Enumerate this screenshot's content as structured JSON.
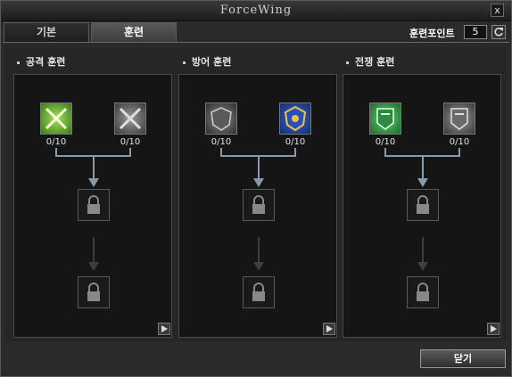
{
  "window": {
    "title": "ForceWing",
    "close_glyph": "x"
  },
  "tabs": [
    {
      "label": "기본",
      "active": false
    },
    {
      "label": "훈련",
      "active": true
    }
  ],
  "points": {
    "label": "훈련포인트",
    "value": "5"
  },
  "sections": [
    {
      "title": "공격 훈련",
      "left_count": "0/10",
      "right_count": "0/10",
      "left_icon": "green-crossed-swords-icon",
      "right_icon": "gray-crossed-swords-icon"
    },
    {
      "title": "방어 훈련",
      "left_count": "0/10",
      "right_count": "0/10",
      "left_icon": "gray-shield-emblem-icon",
      "right_icon": "blue-gold-shield-icon"
    },
    {
      "title": "전쟁 훈련",
      "left_count": "0/10",
      "right_count": "0/10",
      "left_icon": "green-banner-shield-icon",
      "right_icon": "gray-banner-shield-icon"
    }
  ],
  "footer": {
    "close_label": "닫기"
  },
  "colors": {
    "background": "#2a2a2a",
    "panel": "#151515",
    "connector": "#8a98a8",
    "active_tab": "#4a4a4a"
  }
}
